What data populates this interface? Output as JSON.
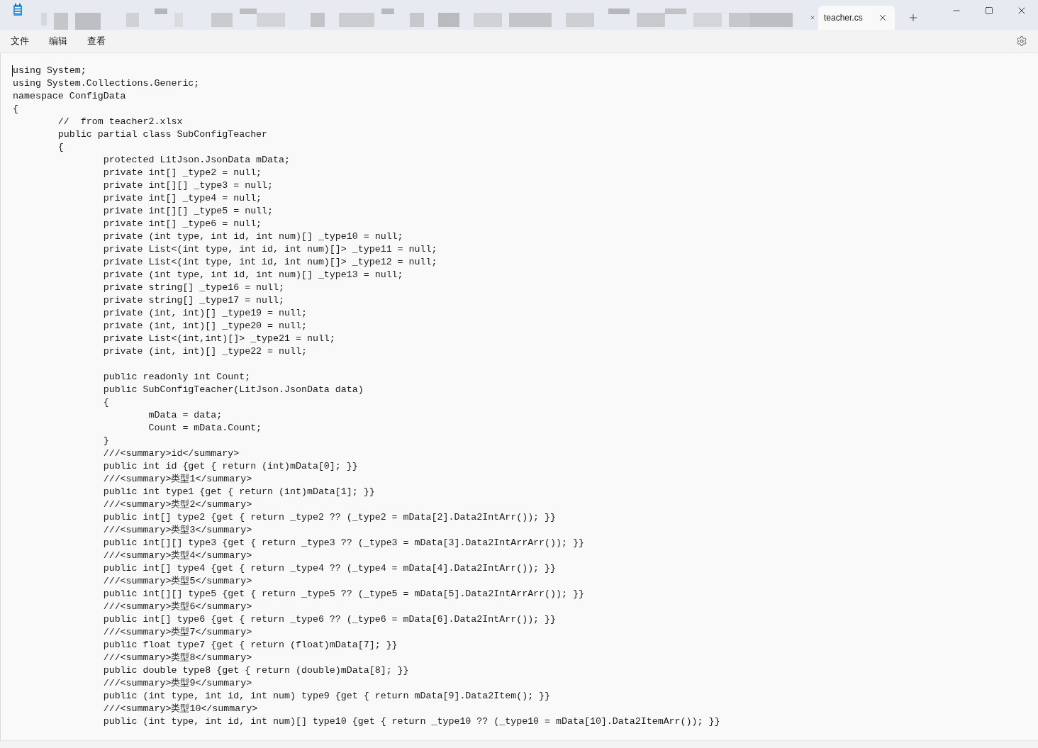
{
  "window": {
    "active_tab": {
      "title": "teacher.cs",
      "selected": true
    }
  },
  "menu": [
    "文件",
    "编辑",
    "查看"
  ],
  "editor": {
    "lines": [
      {
        "kind": "code",
        "text": "using System;"
      },
      {
        "kind": "code",
        "text": "using System.Collections.Generic;"
      },
      {
        "kind": "code",
        "text": "namespace ConfigData"
      },
      {
        "kind": "code",
        "text": "{"
      },
      {
        "kind": "code",
        "text": "\t//  from teacher2.xlsx"
      },
      {
        "kind": "code",
        "text": "\tpublic partial class SubConfigTeacher"
      },
      {
        "kind": "code",
        "text": "\t{"
      },
      {
        "kind": "code",
        "text": "\t\tprotected LitJson.JsonData mData;"
      },
      {
        "kind": "code",
        "text": "\t\tprivate int[] _type2 = null;"
      },
      {
        "kind": "code",
        "text": "\t\tprivate int[][] _type3 = null;"
      },
      {
        "kind": "code",
        "text": "\t\tprivate int[] _type4 = null;"
      },
      {
        "kind": "code",
        "text": "\t\tprivate int[][] _type5 = null;"
      },
      {
        "kind": "code",
        "text": "\t\tprivate int[] _type6 = null;"
      },
      {
        "kind": "code",
        "text": "\t\tprivate (int type, int id, int num)[] _type10 = null;"
      },
      {
        "kind": "code",
        "text": "\t\tprivate List<(int type, int id, int num)[]> _type11 = null;"
      },
      {
        "kind": "code",
        "text": "\t\tprivate List<(int type, int id, int num)[]> _type12 = null;"
      },
      {
        "kind": "code",
        "text": "\t\tprivate (int type, int id, int num)[] _type13 = null;"
      },
      {
        "kind": "code",
        "text": "\t\tprivate string[] _type16 = null;"
      },
      {
        "kind": "code",
        "text": "\t\tprivate string[] _type17 = null;"
      },
      {
        "kind": "code",
        "text": "\t\tprivate (int, int)[] _type19 = null;"
      },
      {
        "kind": "code",
        "text": "\t\tprivate (int, int)[] _type20 = null;"
      },
      {
        "kind": "code",
        "text": "\t\tprivate List<(int,int)[]> _type21 = null;"
      },
      {
        "kind": "code",
        "text": "\t\tprivate (int, int)[] _type22 = null;"
      },
      {
        "kind": "blank"
      },
      {
        "kind": "code",
        "text": "\t\tpublic readonly int Count;"
      },
      {
        "kind": "code",
        "text": "\t\tpublic SubConfigTeacher(LitJson.JsonData data)"
      },
      {
        "kind": "code",
        "text": "\t\t{"
      },
      {
        "kind": "code",
        "text": "\t\t\tmData = data;"
      },
      {
        "kind": "code",
        "text": "\t\t\tCount = mData.Count;"
      },
      {
        "kind": "code",
        "text": "\t\t}"
      },
      {
        "kind": "code",
        "text": "\t\t///<summary>id</summary>"
      },
      {
        "kind": "code",
        "text": "\t\tpublic int id {get { return (int)mData[0]; }}"
      },
      {
        "kind": "code",
        "text": "\t\t///<summary>类型1</summary>"
      },
      {
        "kind": "code",
        "text": "\t\tpublic int type1 {get { return (int)mData[1]; }}"
      },
      {
        "kind": "code",
        "text": "\t\t///<summary>类型2</summary>"
      },
      {
        "kind": "code",
        "text": "\t\tpublic int[] type2 {get { return _type2 ?? (_type2 = mData[2].Data2IntArr()); }}"
      },
      {
        "kind": "code",
        "text": "\t\t///<summary>类型3</summary>"
      },
      {
        "kind": "code",
        "text": "\t\tpublic int[][] type3 {get { return _type3 ?? (_type3 = mData[3].Data2IntArrArr()); }}"
      },
      {
        "kind": "code",
        "text": "\t\t///<summary>类型4</summary>"
      },
      {
        "kind": "code",
        "text": "\t\tpublic int[] type4 {get { return _type4 ?? (_type4 = mData[4].Data2IntArr()); }}"
      },
      {
        "kind": "code",
        "text": "\t\t///<summary>类型5</summary>"
      },
      {
        "kind": "code",
        "text": "\t\tpublic int[][] type5 {get { return _type5 ?? (_type5 = mData[5].Data2IntArrArr()); }}"
      },
      {
        "kind": "code",
        "text": "\t\t///<summary>类型6</summary>"
      },
      {
        "kind": "code",
        "text": "\t\tpublic int[] type6 {get { return _type6 ?? (_type6 = mData[6].Data2IntArr()); }}"
      },
      {
        "kind": "code",
        "text": "\t\t///<summary>类型7</summary>"
      },
      {
        "kind": "code",
        "text": "\t\tpublic float type7 {get { return (float)mData[7]; }}"
      },
      {
        "kind": "code",
        "text": "\t\t///<summary>类型8</summary>"
      },
      {
        "kind": "code",
        "text": "\t\tpublic double type8 {get { return (double)mData[8]; }}"
      },
      {
        "kind": "code",
        "text": "\t\t///<summary>类型9</summary>"
      },
      {
        "kind": "code",
        "text": "\t\tpublic (int type, int id, int num) type9 {get { return mData[9].Data2Item(); }}"
      },
      {
        "kind": "code",
        "text": "\t\t///<summary>类型10</summary>"
      },
      {
        "kind": "code",
        "text": "\t\tpublic (int type, int id, int num)[] type10 {get { return _type10 ?? (_type10 = mData[10].Data2ItemArr()); }}"
      }
    ]
  }
}
